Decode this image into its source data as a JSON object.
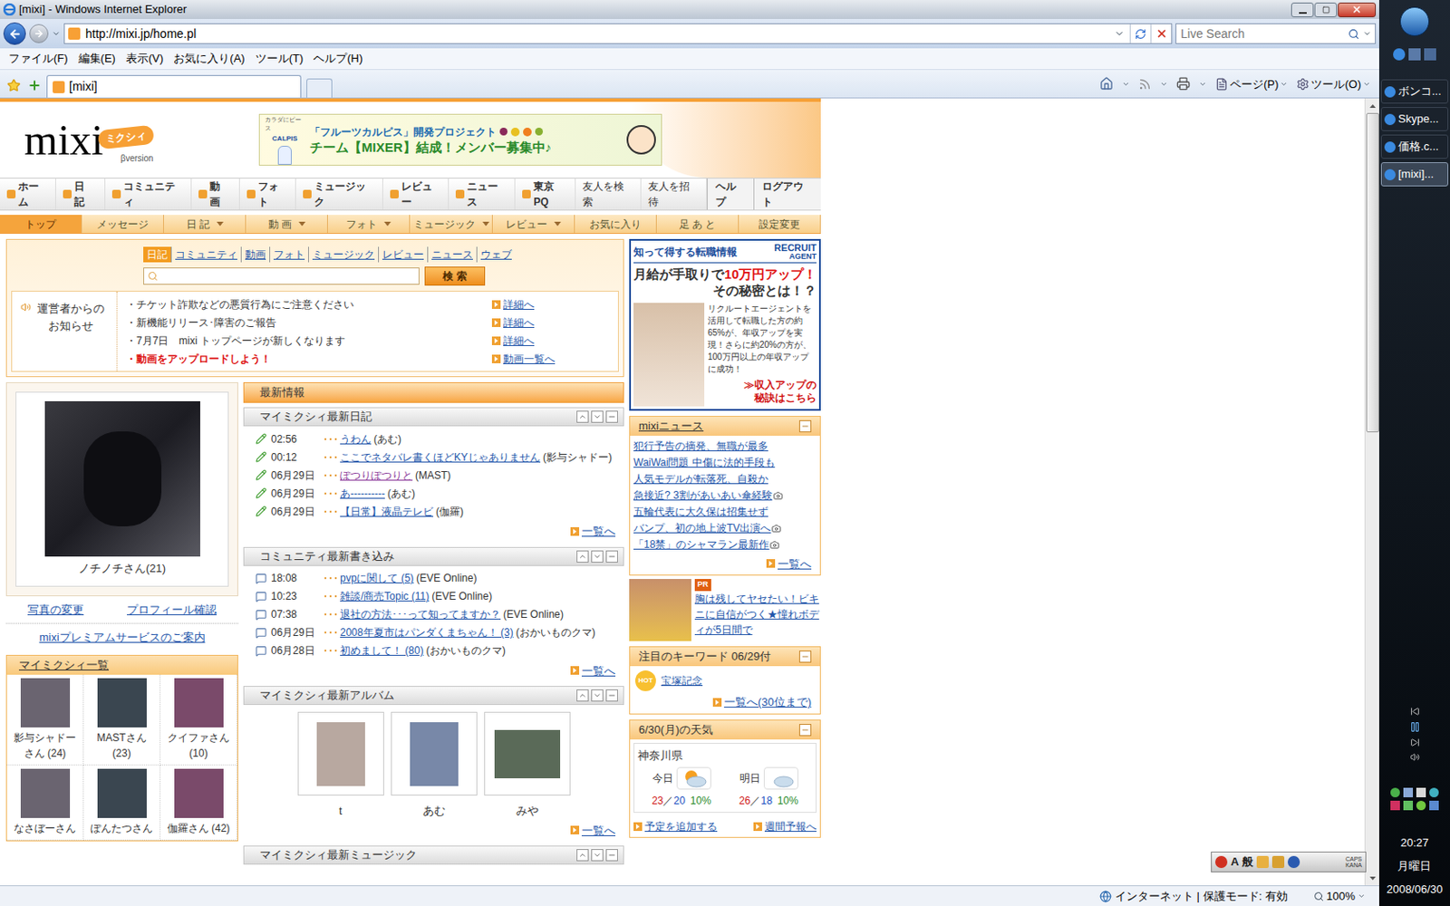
{
  "window": {
    "title": "[mixi] - Windows Internet Explorer"
  },
  "address_bar": {
    "url": "http://mixi.jp/home.pl"
  },
  "search": {
    "placeholder": "Live Search"
  },
  "menu": [
    "ファイル(F)",
    "編集(E)",
    "表示(V)",
    "お気に入り(A)",
    "ツール(T)",
    "ヘルプ(H)"
  ],
  "browser_tabs": [
    {
      "label": "[mixi]",
      "selected": true
    }
  ],
  "command_bar": [
    "ページ(P)",
    "ツール(O)"
  ],
  "status_bar": {
    "zone": "インターネット | 保護モード: 有効",
    "zoom": "100%"
  },
  "mixi": {
    "logo": {
      "text": "mixi",
      "kana": "ミクシィ",
      "version": "βversion"
    },
    "banner": {
      "tagline": "カラダにピース",
      "brand": "CALPIS",
      "line1": "「フルーツカルピス」開発プロジェクト",
      "line2": "チーム【MIXER】結成！メンバー募集中♪"
    },
    "main_nav": [
      {
        "label": "ホーム",
        "kind": "icon"
      },
      {
        "label": "日 記",
        "kind": "icon"
      },
      {
        "label": "コミュニティ",
        "kind": "icon"
      },
      {
        "label": "動 画",
        "kind": "icon"
      },
      {
        "label": "フォト",
        "kind": "icon"
      },
      {
        "label": "ミュージック",
        "kind": "icon"
      },
      {
        "label": "レビュー",
        "kind": "icon"
      },
      {
        "label": "ニュース",
        "kind": "icon"
      },
      {
        "label": "東京PQ",
        "kind": "icon"
      },
      {
        "label": "友人を検索",
        "kind": "plain"
      },
      {
        "label": "友人を招待",
        "kind": "plain"
      },
      {
        "label": "ヘルプ",
        "kind": "tab"
      },
      {
        "label": "ログアウト",
        "kind": "tab"
      }
    ],
    "sub_nav": [
      {
        "label": "トップ",
        "selected": true,
        "dropdown": false
      },
      {
        "label": "メッセージ",
        "selected": false,
        "dropdown": false
      },
      {
        "label": "日 記",
        "selected": false,
        "dropdown": true
      },
      {
        "label": "動 画",
        "selected": false,
        "dropdown": true
      },
      {
        "label": "フォト",
        "selected": false,
        "dropdown": true
      },
      {
        "label": "ミュージック",
        "selected": false,
        "dropdown": true
      },
      {
        "label": "レビュー",
        "selected": false,
        "dropdown": true
      },
      {
        "label": "お気に入り",
        "selected": false,
        "dropdown": false
      },
      {
        "label": "足 あ と",
        "selected": false,
        "dropdown": false
      },
      {
        "label": "設定変更",
        "selected": false,
        "dropdown": false
      }
    ],
    "search_tabs": [
      {
        "label": "日記",
        "selected": true
      },
      {
        "label": "コミュニティ",
        "selected": false
      },
      {
        "label": "動画",
        "selected": false
      },
      {
        "label": "フォト",
        "selected": false
      },
      {
        "label": "ミュージック",
        "selected": false
      },
      {
        "label": "レビュー",
        "selected": false
      },
      {
        "label": "ニュース",
        "selected": false
      },
      {
        "label": "ウェブ",
        "selected": false
      }
    ],
    "search_button": "検 索",
    "notices": {
      "label": "運営者からのお知らせ",
      "items": [
        {
          "text": "・チケット詐欺などの悪質行為にご注意ください",
          "link": "詳細へ",
          "highlight": false
        },
        {
          "text": "・新機能リリース･障害のご報告",
          "link": "詳細へ",
          "highlight": false
        },
        {
          "text": "・7月7日　mixi トップページが新しくなります",
          "link": "詳細へ",
          "highlight": false
        },
        {
          "text": "・動画をアップロードしよう！",
          "link": "動画一覧へ",
          "highlight": true
        }
      ]
    },
    "profile": {
      "name": "ノチノチさん(21)",
      "links": [
        "写真の変更",
        "プロフィール確認"
      ],
      "premium": "mixiプレミアムサービスのご案内"
    },
    "friends": {
      "title": "マイミクシィ一覧",
      "items": [
        {
          "name": "影与シャドーさん (24)"
        },
        {
          "name": "MASTさん (23)"
        },
        {
          "name": "クイファさん (10)"
        },
        {
          "name": "なさぼーさん"
        },
        {
          "name": "ぽんたつさん"
        },
        {
          "name": "伽羅さん (42)"
        }
      ]
    },
    "latest_title": "最新情報",
    "more": "一覧へ",
    "diary": {
      "title": "マイミクシィ最新日記",
      "items": [
        {
          "time": "02:56",
          "title": "うわん",
          "author": "(あむ)",
          "visited": false
        },
        {
          "time": "00:12",
          "title": "ここでネタバレ書くほどKYじゃありません",
          "author": "(影与シャドー)",
          "visited": false
        },
        {
          "time": "06月29日",
          "title": "ぽつりぽつりと",
          "author": "(MAST)",
          "visited": true
        },
        {
          "time": "06月29日",
          "title": "あ----------",
          "author": "(あむ)",
          "visited": false
        },
        {
          "time": "06月29日",
          "title": "【日常】液晶テレビ",
          "author": "(伽羅)",
          "visited": false
        }
      ]
    },
    "community": {
      "title": "コミュニティ最新書き込み",
      "items": [
        {
          "time": "18:08",
          "title": "pvpに関して (5)",
          "author": "(EVE Online)",
          "visited": false
        },
        {
          "time": "10:23",
          "title": "雑談/商売Topic (11)",
          "author": "(EVE Online)",
          "visited": false
        },
        {
          "time": "07:38",
          "title": "退社の方法･･･って知ってますか？",
          "author": "(EVE Online)",
          "visited": false
        },
        {
          "time": "06月29日",
          "title": "2008年夏市はパンダくまちゃん！ (3)",
          "author": "(おかいものクマ)",
          "visited": false
        },
        {
          "time": "06月28日",
          "title": "初めまして！ (80)",
          "author": "(おかいものクマ)",
          "visited": false
        }
      ]
    },
    "album": {
      "title": "マイミクシィ最新アルバム",
      "items": [
        {
          "name": "t"
        },
        {
          "name": "あむ"
        },
        {
          "name": "みや"
        }
      ]
    },
    "music": {
      "title": "マイミクシィ最新ミュージック"
    },
    "recruit": {
      "heading": "知って得する転職情報",
      "brand1": "RECRUIT",
      "brand2": "AGENT",
      "headline1": "月給が手取りで",
      "headline_em": "10万円アップ！",
      "headline2": "その秘密とは！？",
      "body": "リクルートエージェントを活用して転職した方の約65%が、年収アップを実現！さらに約20%の方が、100万円以上の年収アップに成功！",
      "cta1": "≫収入アップの",
      "cta2": "秘訣はこちら"
    },
    "news": {
      "title": "mixiニュース",
      "items": [
        {
          "text": "犯行予告の摘発、無職が最多",
          "photo": false
        },
        {
          "text": "WaiWai問題 中傷に法的手段も",
          "photo": false
        },
        {
          "text": "人気モデルが転落死、自殺か",
          "photo": false
        },
        {
          "text": "急接近? 3割があいあい傘経験",
          "photo": true
        },
        {
          "text": "五輪代表に大久保は招集せず",
          "photo": false
        },
        {
          "text": "バンプ、初の地上波TV出演へ",
          "photo": true
        },
        {
          "text": "「18禁」のシャマラン最新作",
          "photo": true
        }
      ]
    },
    "pr": {
      "badge": "PR",
      "text": "胸は残してヤセたい！ビキニに自信がつく★憧れボディが5日間で"
    },
    "keywords": {
      "title": "注目のキーワード 06/29付",
      "badge": "HOT",
      "items": [
        "宝塚記念"
      ],
      "more": "一覧へ(30位まで)"
    },
    "weather": {
      "title": "6/30(月)の天気",
      "region": "神奈川県",
      "days": [
        {
          "label": "今日",
          "high": "23",
          "sep": "／",
          "low": "20",
          "rain": "10%",
          "kind": "sun"
        },
        {
          "label": "明日",
          "high": "26",
          "sep": "／",
          "low": "18",
          "rain": "10%",
          "kind": "cloud"
        }
      ],
      "links": [
        "予定を追加する",
        "週間予報へ"
      ]
    }
  },
  "taskbar": {
    "items": [
      {
        "label": "ボンコ...",
        "selected": false
      },
      {
        "label": "Skype...",
        "selected": false
      },
      {
        "label": "価格.c...",
        "selected": false
      },
      {
        "label": "[mixi]...",
        "selected": true
      }
    ],
    "clock": {
      "time": "20:27",
      "day": "月曜日",
      "date": "2008/06/30"
    }
  },
  "language_bar": {
    "items": [
      "A",
      "般"
    ],
    "caps": "CAPS",
    "kana": "KANA"
  }
}
